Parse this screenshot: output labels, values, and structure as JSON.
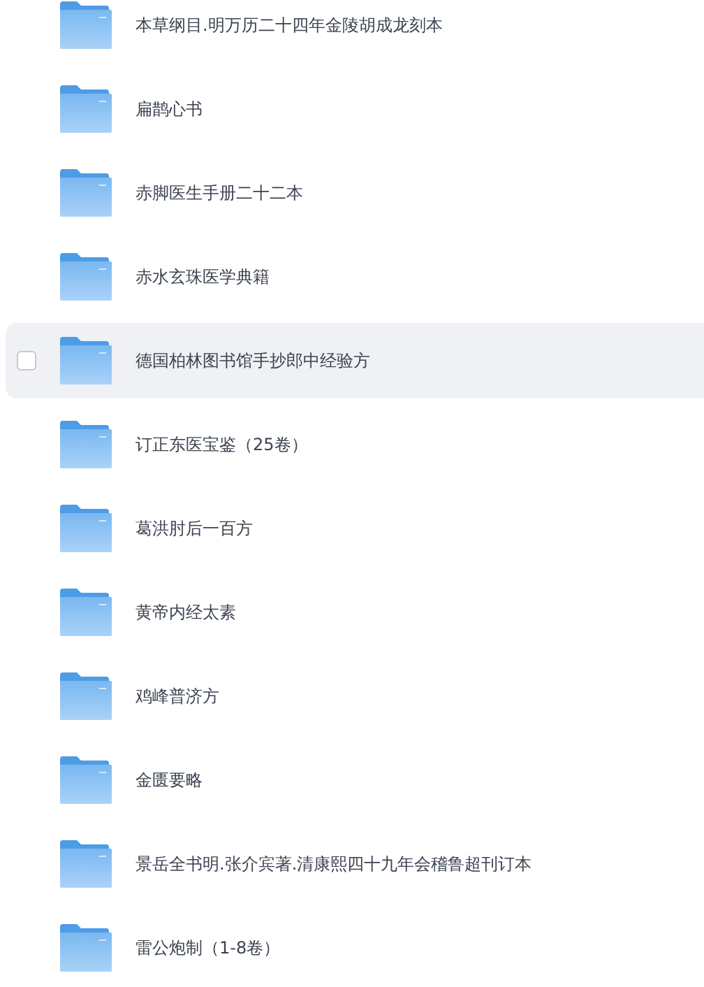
{
  "folders": [
    {
      "name": "本草纲目.明万历二十四年金陵胡成龙刻本",
      "hovered": false,
      "checked": false
    },
    {
      "name": "扁鹊心书",
      "hovered": false,
      "checked": false
    },
    {
      "name": "赤脚医生手册二十二本",
      "hovered": false,
      "checked": false
    },
    {
      "name": "赤水玄珠医学典籍",
      "hovered": false,
      "checked": false
    },
    {
      "name": "德国柏林图书馆手抄郎中经验方",
      "hovered": true,
      "checked": false
    },
    {
      "name": "订正东医宝鉴（25卷）",
      "hovered": false,
      "checked": false
    },
    {
      "name": "葛洪肘后一百方",
      "hovered": false,
      "checked": false
    },
    {
      "name": "黄帝内经太素",
      "hovered": false,
      "checked": false
    },
    {
      "name": "鸡峰普济方",
      "hovered": false,
      "checked": false
    },
    {
      "name": "金匮要略",
      "hovered": false,
      "checked": false
    },
    {
      "name": "景岳全书明.张介宾著.清康熙四十九年会稽鲁超刊订本",
      "hovered": false,
      "checked": false
    },
    {
      "name": "雷公炮制（1-8卷）",
      "hovered": false,
      "checked": false
    }
  ]
}
